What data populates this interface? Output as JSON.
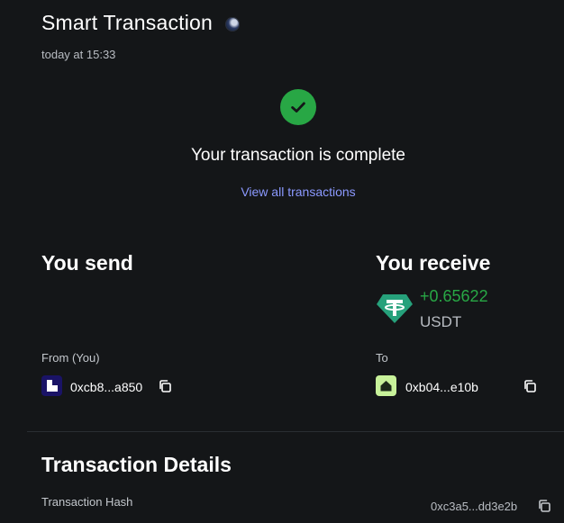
{
  "header": {
    "title": "Smart Transaction",
    "timestamp": "today at 15:33",
    "network_icon": "network-icon"
  },
  "status": {
    "icon": "check-circle-icon",
    "message": "Your transaction is complete",
    "link_text": "View all transactions",
    "colors": {
      "success": "#28a745",
      "link": "#8b99ff"
    }
  },
  "send": {
    "heading": "You send",
    "from_label": "From (You)",
    "from_address": "0xcb8...a850"
  },
  "receive": {
    "heading": "You receive",
    "amount": "+0.65622",
    "token": "USDT",
    "token_icon": "tether-icon",
    "to_label": "To",
    "to_address": "0xb04...e10b"
  },
  "details": {
    "heading": "Transaction Details",
    "hash_label": "Transaction Hash",
    "hash_value": "0xc3a5...dd3e2b"
  }
}
